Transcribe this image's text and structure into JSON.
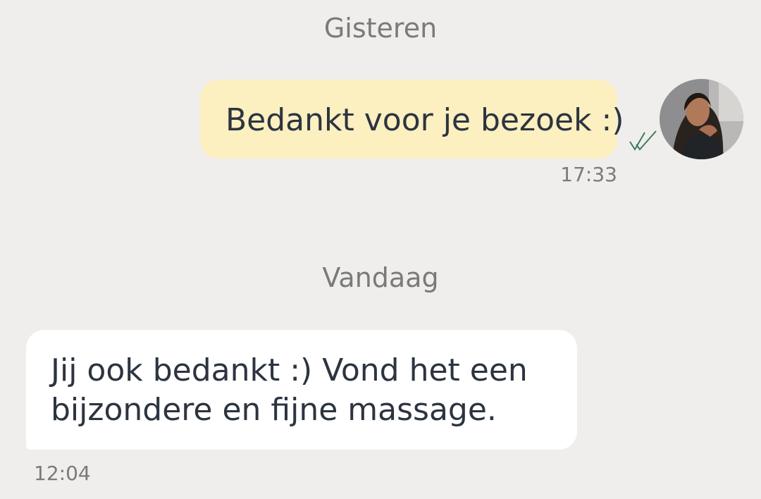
{
  "chat": {
    "separators": {
      "yesterday": "Gisteren",
      "today": "Vandaag"
    },
    "messages": [
      {
        "direction": "outgoing",
        "text": "Bedankt voor je bezoek :)",
        "time": "17:33",
        "status_icon": "double-check-icon"
      },
      {
        "direction": "incoming",
        "text_lines": [
          "Jij ook bedankt :) Vond het een",
          "bijzondere en fijne massage."
        ],
        "time": "12:04"
      }
    ],
    "avatar_icon": "contact-avatar"
  },
  "colors": {
    "background": "#efeeec",
    "outgoing_bubble": "#fcefc0",
    "incoming_bubble": "#ffffff",
    "message_text": "#2c3440",
    "meta_text": "#7a7a7a",
    "check_color": "#3f7a5a"
  }
}
